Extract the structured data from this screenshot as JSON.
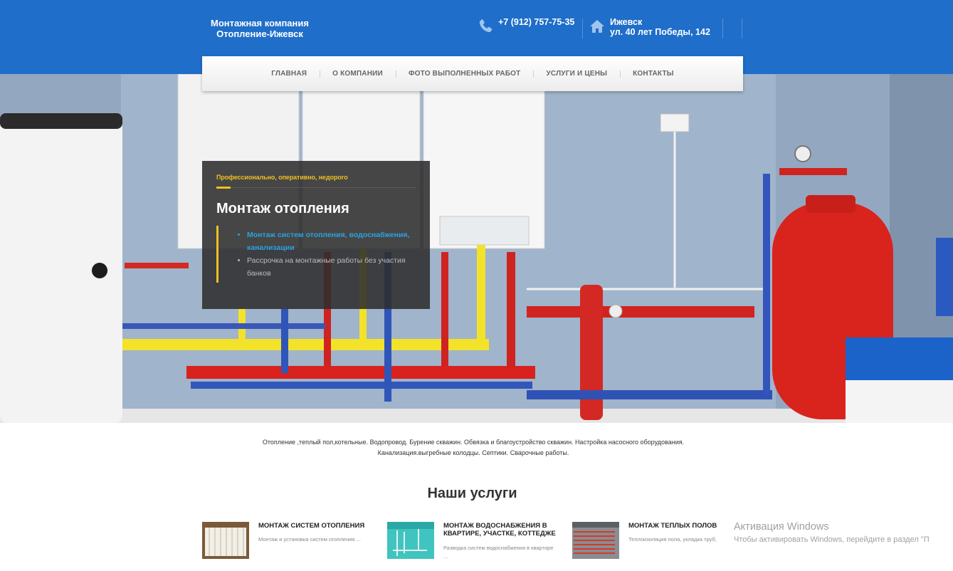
{
  "header": {
    "brand_line1": "Монтажная компания",
    "brand_line2": "Отопление-Ижевск",
    "phone": "+7 (912) 757-75-35",
    "city": "Ижевск",
    "address": "ул. 40 лет Победы, 142"
  },
  "nav": {
    "items": [
      "ГЛАВНАЯ",
      "О КОМПАНИИ",
      "ФОТО ВЫПОЛНЕННЫХ РАБОТ",
      "УСЛУГИ И ЦЕНЫ",
      "КОНТАКТЫ"
    ]
  },
  "hero": {
    "tagline": "Профессионально, оперативно, недорого",
    "title": "Монтаж отопления",
    "bullets": [
      "Монтаж систем отопления, водоснабжения, канализации",
      "Рассрочка на монтажные работы без участия банков"
    ]
  },
  "description": {
    "line1": "Отопление ,теплый пол,котельные. Водопровод. Бурение скважин. Обвязка и благоустройство скважин. Настройка насосного оборудования.",
    "line2": "Канализация.выгребные колодцы. Септики. Сварочные работы."
  },
  "services": {
    "title": "Наши услуги",
    "items": [
      {
        "title": "МОНТАЖ СИСТЕМ ОТОПЛЕНИЯ",
        "desc": " Монтаж и установка систем отопления ..."
      },
      {
        "title": "МОНТАЖ ВОДОСНАБЖЕНИЯ В КВАРТИРЕ, УЧАСТКЕ, КОТТЕДЖЕ",
        "desc": "Разводка систем водоснабжения в квартире ..."
      },
      {
        "title": "МОНТАЖ ТЕПЛЫХ ПОЛОВ",
        "desc": "Теплоизоляция пола, укладка труб,"
      }
    ]
  },
  "windows_notice": {
    "line1": "Активация Windows",
    "line2": "Чтобы активировать Windows, перейдите в раздел \"П"
  },
  "colors": {
    "header_blue": "#1f6ec9",
    "accent_yellow": "#f0c020",
    "link_blue": "#2aa3e0",
    "card_bg": "#2d2d2d"
  },
  "icons": [
    "phone-icon",
    "home-icon"
  ]
}
